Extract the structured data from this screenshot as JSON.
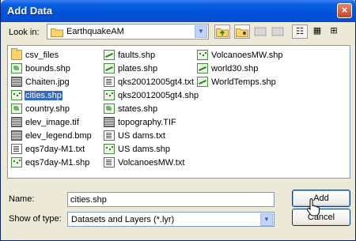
{
  "window": {
    "title": "Add Data",
    "close": "×"
  },
  "toolbar": {
    "look_in_label": "Look in:",
    "look_in_value": "EarthquakeAM",
    "up_glyph": "⮤",
    "view_glyphs": [
      "☷",
      "▦",
      "⊞"
    ]
  },
  "files": {
    "col1": [
      {
        "name": "csv_files",
        "icon": "folder-icon",
        "kind": "folder"
      },
      {
        "name": "bounds.shp",
        "icon": "polygon-layer-icon",
        "kind": "poly"
      },
      {
        "name": "Chaiten.jpg",
        "icon": "raster-icon",
        "kind": "raster"
      },
      {
        "name": "cities.shp",
        "icon": "point-layer-icon",
        "kind": "point",
        "selected": true
      },
      {
        "name": "country.shp",
        "icon": "polygon-layer-icon",
        "kind": "poly"
      },
      {
        "name": "elev_image.tif",
        "icon": "raster-icon",
        "kind": "raster"
      },
      {
        "name": "elev_legend.bmp",
        "icon": "raster-icon",
        "kind": "raster"
      },
      {
        "name": "eqs7day-M1.txt",
        "icon": "text-file-icon",
        "kind": "text"
      },
      {
        "name": "eqs7day-M1.shp",
        "icon": "point-layer-icon",
        "kind": "point"
      }
    ],
    "col2": [
      {
        "name": "faults.shp",
        "icon": "line-layer-icon",
        "kind": "line"
      },
      {
        "name": "plates.shp",
        "icon": "line-layer-icon",
        "kind": "line"
      },
      {
        "name": "qks20012005gt4.txt",
        "icon": "text-file-icon",
        "kind": "text"
      },
      {
        "name": "qks20012005gt4.shp",
        "icon": "point-layer-icon",
        "kind": "point"
      },
      {
        "name": "states.shp",
        "icon": "polygon-layer-icon",
        "kind": "poly"
      },
      {
        "name": "topography.TIF",
        "icon": "raster-icon",
        "kind": "raster"
      },
      {
        "name": "US dams.txt",
        "icon": "text-file-icon",
        "kind": "text"
      },
      {
        "name": "US dams.shp",
        "icon": "point-layer-icon",
        "kind": "point"
      },
      {
        "name": "VolcanoesMW.txt",
        "icon": "text-file-icon",
        "kind": "text"
      }
    ],
    "col3": [
      {
        "name": "VolcanoesMW.shp",
        "icon": "point-layer-icon",
        "kind": "point"
      },
      {
        "name": "world30.shp",
        "icon": "line-layer-icon",
        "kind": "line"
      },
      {
        "name": "WorldTemps.shp",
        "icon": "line-layer-icon",
        "kind": "line"
      }
    ]
  },
  "form": {
    "name_label": "Name:",
    "name_value": "cities.shp",
    "type_label": "Show of type:",
    "type_value": "Datasets and Layers (*.lyr)"
  },
  "buttons": {
    "add": "Add",
    "cancel": "Cancel"
  }
}
